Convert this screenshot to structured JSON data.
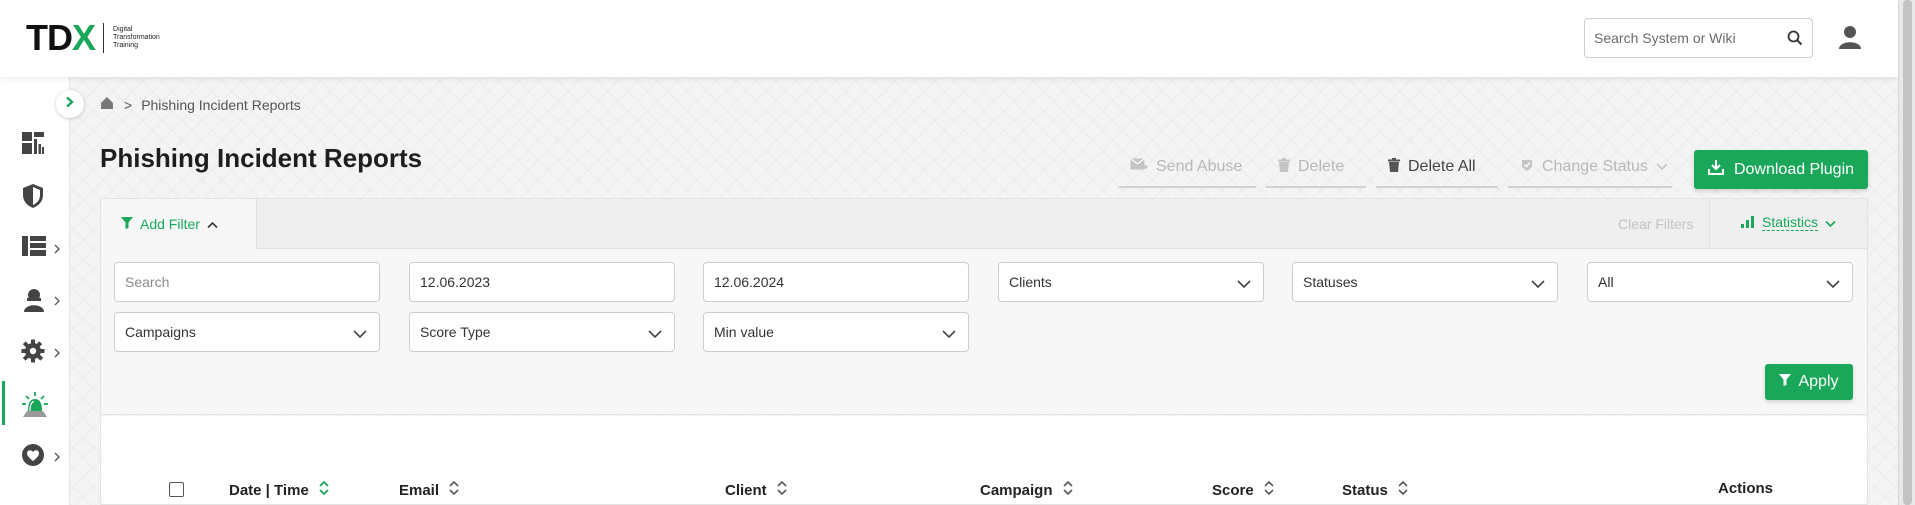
{
  "brand": {
    "logo_text_a": "TD",
    "logo_text_b": "X",
    "logo_subtitle_1": "Digital",
    "logo_subtitle_2": "Transformation",
    "logo_subtitle_3": "Training",
    "accent_color": "#1aa75a"
  },
  "header": {
    "search_placeholder": "Search System or Wiki",
    "search_icon": "search-icon",
    "user_icon": "user-icon"
  },
  "sidebar": {
    "toggle_icon": "chevron-right-icon",
    "items": [
      {
        "icon": "dashboard-icon",
        "has_submenu": false,
        "active": false
      },
      {
        "icon": "shield-icon",
        "has_submenu": false,
        "active": false
      },
      {
        "icon": "layout-list-icon",
        "has_submenu": true,
        "active": false
      },
      {
        "icon": "user-group-icon",
        "has_submenu": true,
        "active": false
      },
      {
        "icon": "gear-icon",
        "has_submenu": true,
        "active": false
      },
      {
        "icon": "alarm-siren-icon",
        "has_submenu": false,
        "active": true
      },
      {
        "icon": "heart-icon",
        "has_submenu": true,
        "active": false
      }
    ]
  },
  "breadcrumb": {
    "home_icon": "home-icon",
    "separator": ">",
    "current": "Phishing Incident Reports"
  },
  "page": {
    "title": "Phishing Incident Reports"
  },
  "toolbar": {
    "send_abuse": "Send Abuse",
    "delete": "Delete",
    "delete_all": "Delete All",
    "change_status": "Change Status",
    "download_plugin": "Download Plugin"
  },
  "filters": {
    "add_filter": "Add Filter",
    "clear_filters": "Clear Filters",
    "statistics": "Statistics",
    "search_placeholder": "Search",
    "date_from": "12.06.2023",
    "date_to": "12.06.2024",
    "clients": "Clients",
    "statuses": "Statuses",
    "all": "All",
    "campaigns": "Campaigns",
    "score_type": "Score Type",
    "min_value": "Min value",
    "apply": "Apply"
  },
  "table": {
    "columns": [
      "Date | Time",
      "Email",
      "Client",
      "Campaign",
      "Score",
      "Status",
      "Actions"
    ]
  }
}
